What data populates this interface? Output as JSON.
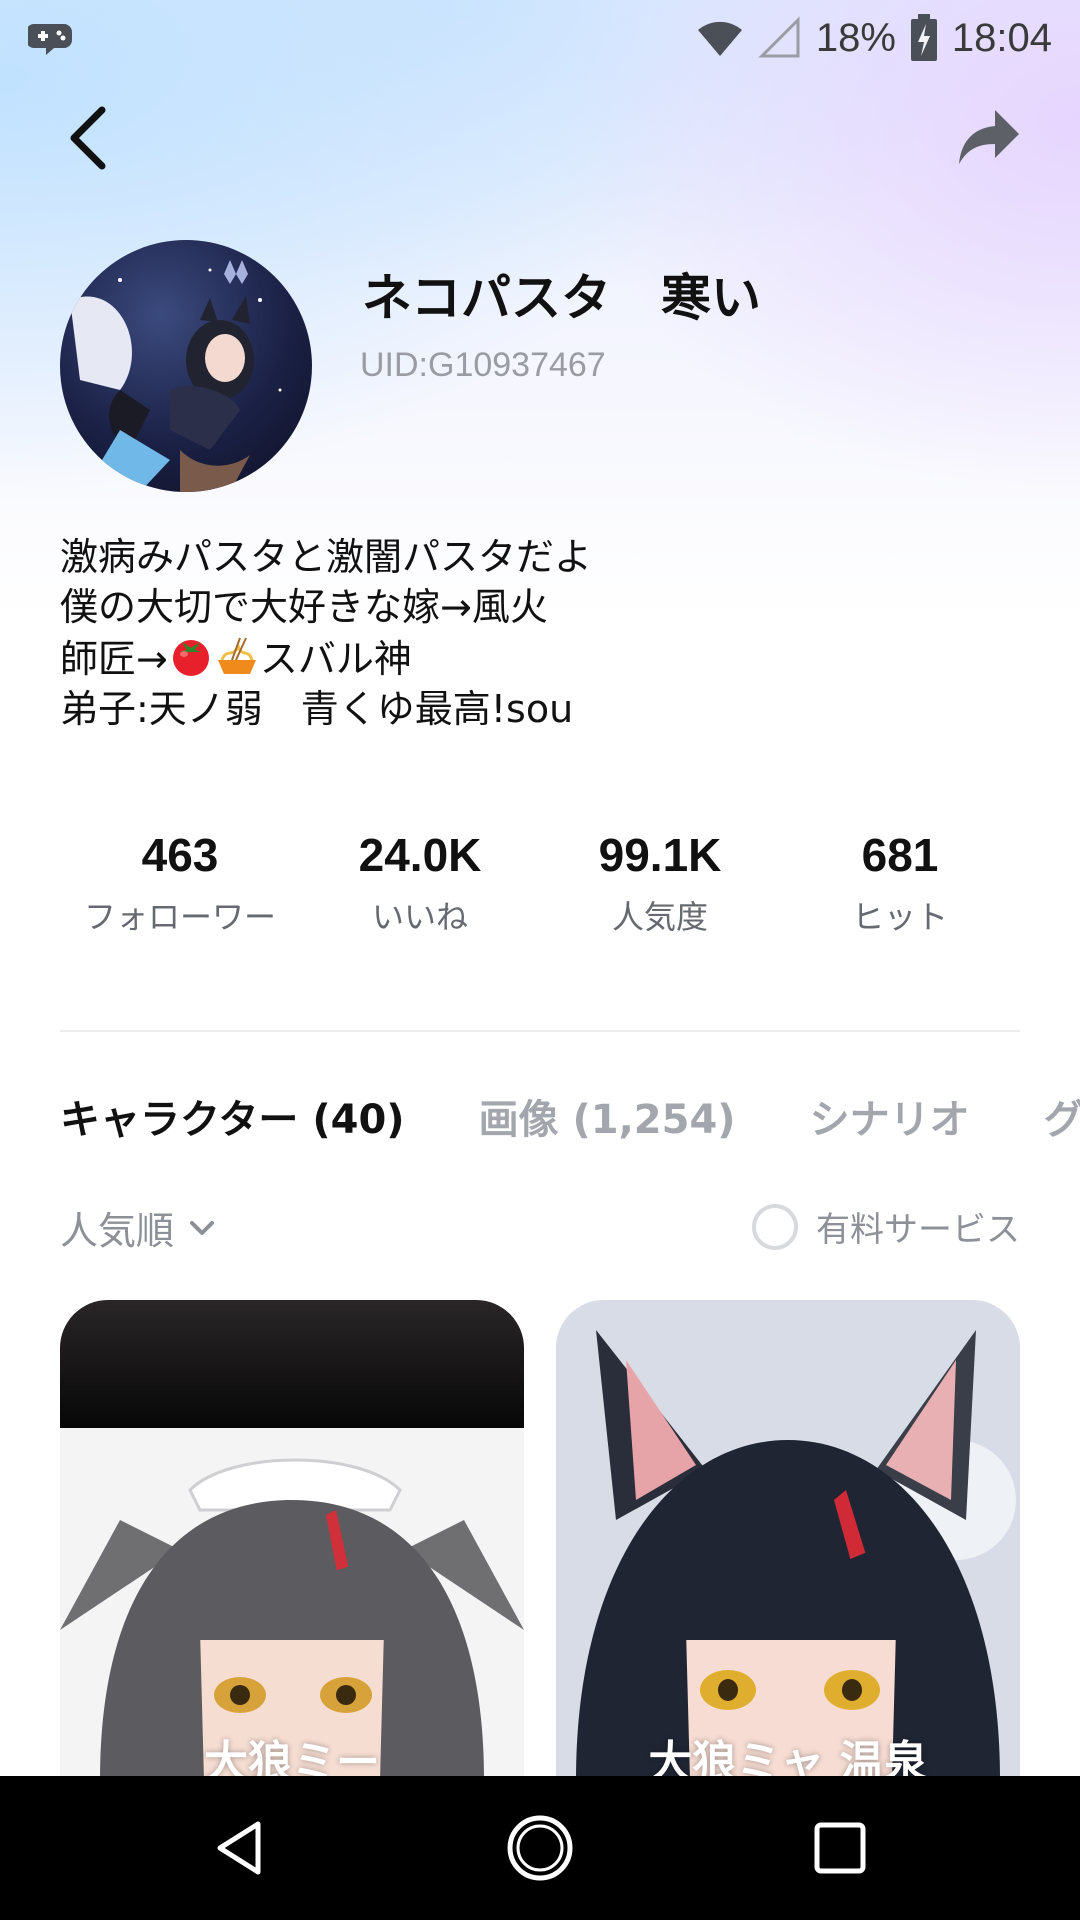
{
  "status_bar": {
    "battery": "18%",
    "time": "18:04"
  },
  "profile": {
    "name": "ネコパスタ　寒い",
    "uid": "UID:G10937467",
    "bio": {
      "line1": "激病みパスタと激闇パスタだよ",
      "line2": "僕の大切で大好きな嫁→風火",
      "line3_prefix": "師匠→",
      "line3_suffix": "スバル神",
      "line4": "弟子:天ノ弱　青くゆ最高!sou"
    }
  },
  "stats": [
    {
      "value": "463",
      "label": "フォローワー"
    },
    {
      "value": "24.0K",
      "label": "いいね"
    },
    {
      "value": "99.1K",
      "label": "人気度"
    },
    {
      "value": "681",
      "label": "ヒット"
    }
  ],
  "tabs": [
    {
      "label": "キャラクター (40)",
      "active": true
    },
    {
      "label": "画像 (1,254)",
      "active": false
    },
    {
      "label": "シナリオ",
      "active": false
    },
    {
      "label": "グル",
      "active": false
    }
  ],
  "sort": {
    "label": "人気順"
  },
  "filter": {
    "label": "有料サービス"
  },
  "cards": [
    {
      "title": "大狼ミー"
    },
    {
      "title": "大狼ミャ 温泉"
    }
  ],
  "colors": {
    "accent_text": "#111111",
    "muted_text": "#9a9ca3",
    "nav_bar": "#000000"
  },
  "icons": {
    "status_app": "game-controller-chat-icon",
    "wifi": "wifi-icon",
    "signal": "cell-signal-icon",
    "battery": "battery-charging-icon",
    "back": "chevron-left-icon",
    "share": "share-arrow-icon",
    "sort": "chevron-down-icon"
  }
}
